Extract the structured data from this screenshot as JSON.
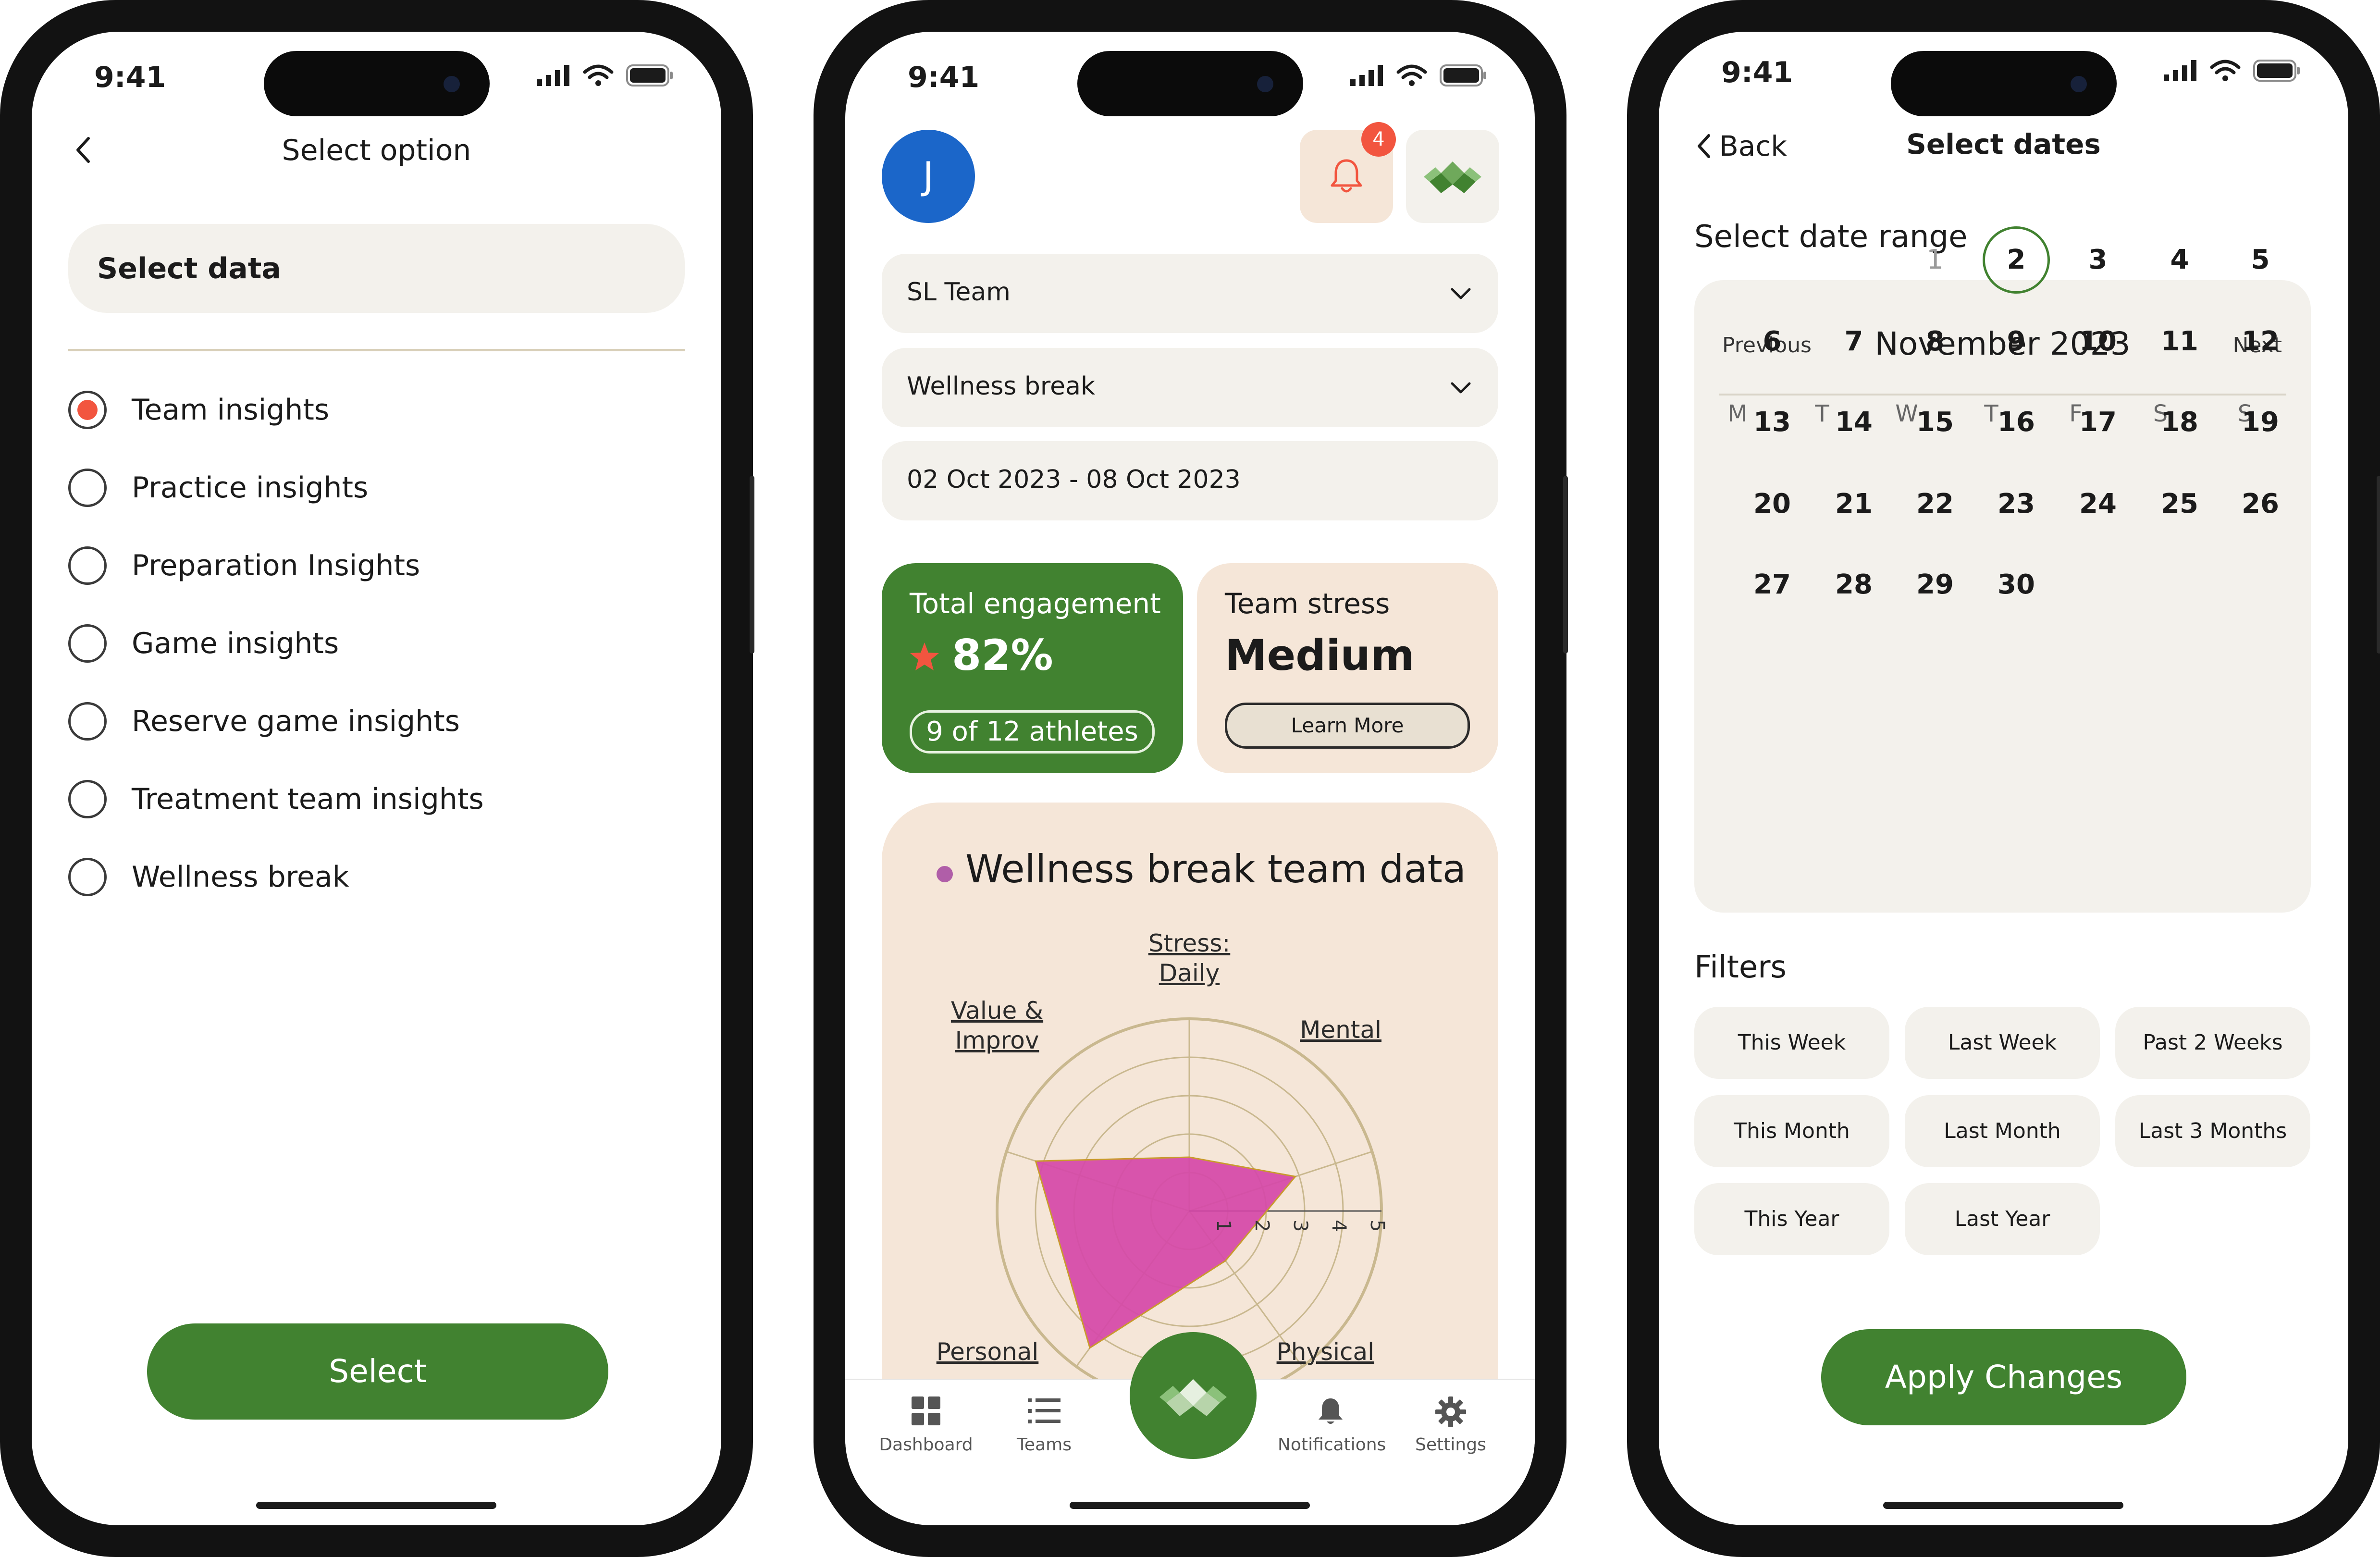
{
  "status_time": "9:41",
  "screen1": {
    "title": "Select option",
    "select_label": "Select data",
    "options": [
      "Team insights",
      "Practice insights",
      "Preparation Insights",
      "Game insights",
      "Reserve game insights",
      "Treatment team insights",
      "Wellness break"
    ],
    "selected_index": 0,
    "button": "Select"
  },
  "screen2": {
    "avatar_letter": "J",
    "notification_count": "4",
    "team_dropdown": "SL Team",
    "type_dropdown": "Wellness break",
    "date_range": "02 Oct 2023 - 08 Oct 2023",
    "engagement": {
      "title": "Total engagement",
      "value": "82%",
      "athletes": "9 of 12 athletes"
    },
    "stress": {
      "title": "Team stress",
      "value": "Medium",
      "button": "Learn More"
    },
    "chart_title": "Wellness break team data",
    "nav": {
      "dashboard": "Dashboard",
      "teams": "Teams",
      "notifications": "Notifications",
      "settings": "Settings"
    }
  },
  "chart_data": {
    "type": "radar",
    "title": "Wellness break team data",
    "axes": [
      "Stress: Daily",
      "Mental",
      "Physical",
      "Personal",
      "Value & Improv"
    ],
    "axis_label_lines": [
      [
        "Stress:",
        "Daily"
      ],
      [
        "Mental"
      ],
      [
        "Physical"
      ],
      [
        "Personal"
      ],
      [
        "Value &",
        "Improv"
      ]
    ],
    "scale_ticks": [
      "1",
      "2",
      "3",
      "4",
      "5"
    ],
    "rmax": 5,
    "series": [
      {
        "values": [
          1.4,
          2.9,
          1.6,
          4.4,
          4.2
        ]
      }
    ],
    "colors": {
      "fill": "#d548a8",
      "stroke": "#c99a2e",
      "grid": "#c9b88f"
    }
  },
  "screen3": {
    "back": "Back",
    "title": "Select dates",
    "section": "Select date range",
    "prev": "Previous",
    "next": "Next",
    "month": "November 2023",
    "weekdays": [
      "M",
      "T",
      "W",
      "T",
      "F",
      "S",
      "S"
    ],
    "days": [
      "1",
      "2",
      "3",
      "4",
      "5",
      "6",
      "7",
      "8",
      "9",
      "10",
      "11",
      "12",
      "13",
      "14",
      "15",
      "16",
      "17",
      "18",
      "19",
      "20",
      "21",
      "22",
      "23",
      "24",
      "25",
      "26",
      "27",
      "28",
      "29",
      "30"
    ],
    "first_weekday_index": 2,
    "selected_day": "2",
    "filters_title": "Filters",
    "filters": [
      "This Week",
      "Last Week",
      "Past 2 Weeks",
      "This Month",
      "Last Month",
      "Last 3 Months",
      "This Year",
      "Last Year"
    ],
    "button": "Apply Changes"
  },
  "colors": {
    "green": "#418230",
    "accent_red": "#f2553f",
    "beige": "#f5e6d8",
    "light": "#f3f1ec"
  }
}
